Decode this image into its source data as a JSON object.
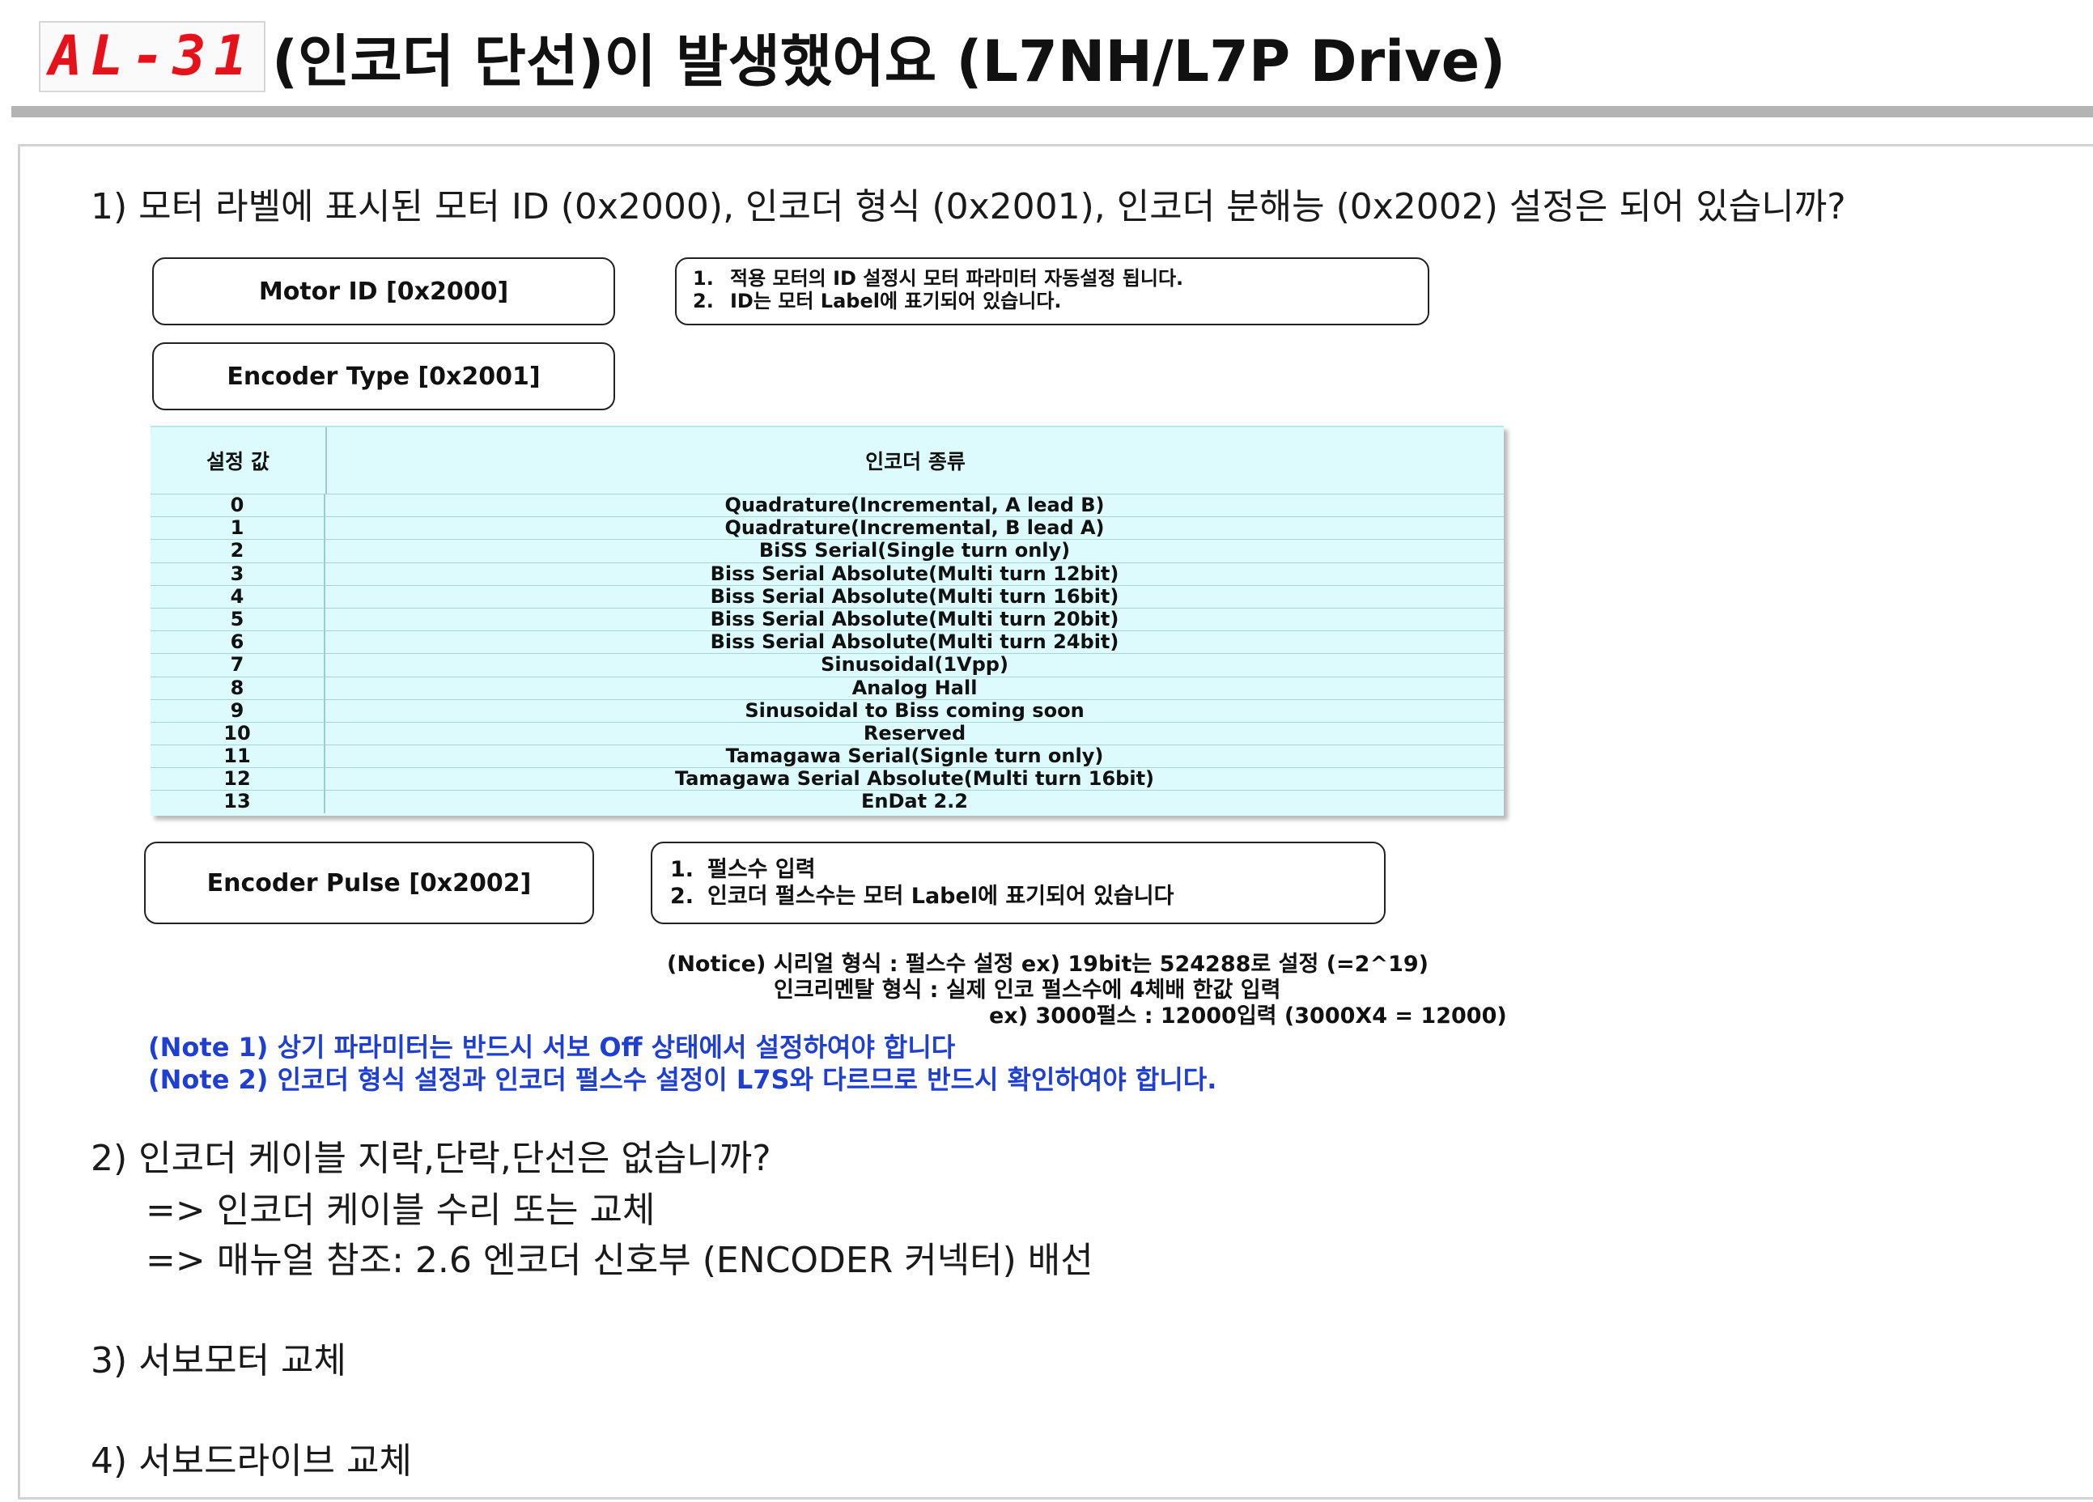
{
  "header": {
    "alarm_code": "AL-31",
    "title": "(인코더 단선)이 발생했어요 (L7NH/L7P Drive)"
  },
  "q1": {
    "text": "1) 모터 라벨에 표시된 모터 ID (0x2000), 인코더 형식 (0x2001), 인코더 분해능 (0x2002) 설정은 되어 있습니까?",
    "motor_id_label": "Motor ID [0x2000]",
    "motor_id_notes": [
      {
        "num": "1.",
        "text": "적용 모터의 ID 설정시 모터 파라미터 자동설정 됩니다."
      },
      {
        "num": "2.",
        "text": "ID는 모터 Label에 표기되어 있습니다."
      }
    ],
    "encoder_type_label": "Encoder Type [0x2001]",
    "table": {
      "headers": {
        "code": "설정 값",
        "type": "인코더 종류"
      },
      "rows": [
        {
          "code": "0",
          "type": "Quadrature(Incremental, A lead B)"
        },
        {
          "code": "1",
          "type": "Quadrature(Incremental, B lead A)"
        },
        {
          "code": "2",
          "type": "BiSS Serial(Single turn only)"
        },
        {
          "code": "3",
          "type": "Biss Serial Absolute(Multi turn 12bit)"
        },
        {
          "code": "4",
          "type": "Biss Serial Absolute(Multi turn 16bit)"
        },
        {
          "code": "5",
          "type": "Biss Serial Absolute(Multi turn 20bit)"
        },
        {
          "code": "6",
          "type": "Biss Serial Absolute(Multi turn 24bit)"
        },
        {
          "code": "7",
          "type": "Sinusoidal(1Vpp)"
        },
        {
          "code": "8",
          "type": "Analog Hall"
        },
        {
          "code": "9",
          "type": "Sinusoidal to Biss coming soon"
        },
        {
          "code": "10",
          "type": "Reserved"
        },
        {
          "code": "11",
          "type": "Tamagawa Serial(Signle turn only)"
        },
        {
          "code": "12",
          "type": "Tamagawa Serial Absolute(Multi turn 16bit)"
        },
        {
          "code": "13",
          "type": "EnDat 2.2"
        }
      ]
    },
    "encoder_pulse_label": "Encoder Pulse  [0x2002]",
    "encoder_pulse_notes": [
      {
        "num": "1.",
        "text": "펄스수 입력"
      },
      {
        "num": "2.",
        "text": "인코더 펄스수는 모터 Label에 표기되어 있습니다"
      }
    ],
    "notice_lines": [
      "(Notice) 시리얼 형식 : 펄스수 설정 ex) 19bit는 524288로 설정 (=2^19)",
      "인크리멘탈 형식 : 실제 인코  펄스수에 4체배 한값 입력",
      "ex) 3000펄스 : 12000입력 (3000X4  = 12000)"
    ],
    "note1": "(Note 1) 상기 파라미터는 반드시 서보 Off 상태에서 설정하여야 합니다",
    "note2": "(Note 2) 인코더 형식 설정과 인코더 펄스수 설정이 L7S와 다르므로 반드시 확인하여야 합니다."
  },
  "q2": {
    "text": "2) 인코더 케이블 지락,단락,단선은 없습니까?",
    "answers": [
      "=> 인코더 케이블 수리 또는 교체",
      "=> 매뉴얼 참조: 2.6 엔코더 신호부 (ENCODER 커넥터) 배선"
    ]
  },
  "q3": {
    "text": "3) 서보모터 교체"
  },
  "q4": {
    "text": "4) 서보드라이브 교체"
  }
}
